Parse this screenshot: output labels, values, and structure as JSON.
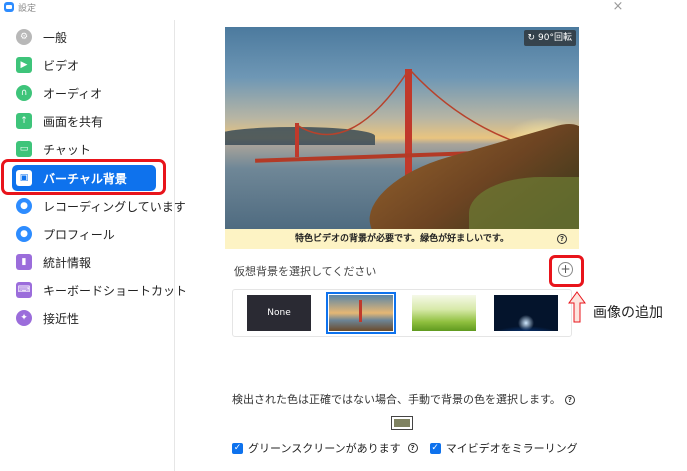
{
  "window": {
    "title": "設定",
    "close_label": "×"
  },
  "sidebar": {
    "items": [
      {
        "label": "一般",
        "icon": "gear-icon",
        "color": "#b8b8b8"
      },
      {
        "label": "ビデオ",
        "icon": "video-icon",
        "color": "#3ec47a"
      },
      {
        "label": "オーディオ",
        "icon": "headphone-icon",
        "color": "#3ec47a"
      },
      {
        "label": "画面を共有",
        "icon": "share-screen-icon",
        "color": "#3ec47a"
      },
      {
        "label": "チャット",
        "icon": "chat-icon",
        "color": "#3ec47a"
      },
      {
        "label": "バーチャル背景",
        "icon": "virtual-background-icon",
        "color": "#ffffff"
      },
      {
        "label": "レコーディングしています",
        "icon": "record-icon",
        "color": "#2d8cff"
      },
      {
        "label": "プロフィール",
        "icon": "profile-icon",
        "color": "#2d8cff"
      },
      {
        "label": "統計情報",
        "icon": "stats-icon",
        "color": "#9b6ddb"
      },
      {
        "label": "キーボードショートカット",
        "icon": "keyboard-icon",
        "color": "#9b6ddb"
      },
      {
        "label": "接近性",
        "icon": "accessibility-icon",
        "color": "#9b6ddb"
      }
    ],
    "active_index": 5
  },
  "preview": {
    "rotate_label": "90°回転",
    "notice": "特色ビデオの背景が必要です。緑色が好ましいです。"
  },
  "backgrounds": {
    "section_label": "仮想背景を選択してください",
    "add_label": "+",
    "thumbnails": [
      {
        "label": "None"
      },
      {
        "label": ""
      },
      {
        "label": ""
      },
      {
        "label": ""
      }
    ],
    "selected_index": 1
  },
  "callout": {
    "text": "画像の追加"
  },
  "detect": {
    "text": "検出された色は正確ではない場合、手動で背景の色を選択します。",
    "swatch_color": "#7f8261"
  },
  "options": {
    "green_screen_label": "グリーンスクリーンがあります",
    "green_screen_checked": true,
    "mirror_label": "マイビデオをミラーリング",
    "mirror_checked": true
  },
  "colors": {
    "accent": "#0e72ed",
    "highlight": "#e8141b",
    "notice_bg": "#fdf3c4"
  }
}
